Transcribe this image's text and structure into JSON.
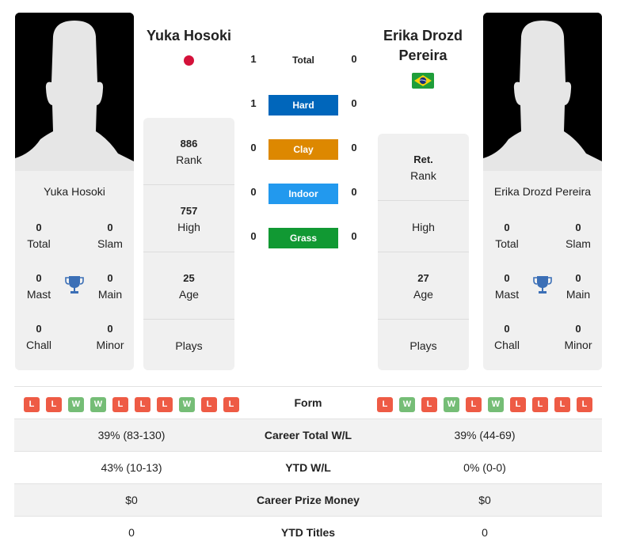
{
  "player1": {
    "name": "Yuka Hosoki",
    "flag": "japan-flag",
    "titles": {
      "total": {
        "value": "0",
        "label": "Total"
      },
      "slam": {
        "value": "0",
        "label": "Slam"
      },
      "mast": {
        "value": "0",
        "label": "Mast"
      },
      "main": {
        "value": "0",
        "label": "Main"
      },
      "chall": {
        "value": "0",
        "label": "Chall"
      },
      "minor": {
        "value": "0",
        "label": "Minor"
      }
    },
    "stats": {
      "rank": {
        "value": "886",
        "label": "Rank"
      },
      "high": {
        "value": "757",
        "label": "High"
      },
      "age": {
        "value": "25",
        "label": "Age"
      },
      "plays": {
        "value": "",
        "label": "Plays"
      }
    },
    "form": [
      "L",
      "L",
      "W",
      "W",
      "L",
      "L",
      "L",
      "W",
      "L",
      "L"
    ]
  },
  "player2": {
    "name_line1": "Erika Drozd",
    "name_line2": "Pereira",
    "name": "Erika Drozd Pereira",
    "flag": "brazil-flag",
    "titles": {
      "total": {
        "value": "0",
        "label": "Total"
      },
      "slam": {
        "value": "0",
        "label": "Slam"
      },
      "mast": {
        "value": "0",
        "label": "Mast"
      },
      "main": {
        "value": "0",
        "label": "Main"
      },
      "chall": {
        "value": "0",
        "label": "Chall"
      },
      "minor": {
        "value": "0",
        "label": "Minor"
      }
    },
    "stats": {
      "rank": {
        "value": "Ret.",
        "label": "Rank"
      },
      "high": {
        "value": "",
        "label": "High"
      },
      "age": {
        "value": "27",
        "label": "Age"
      },
      "plays": {
        "value": "",
        "label": "Plays"
      }
    },
    "form": [
      "L",
      "W",
      "L",
      "W",
      "L",
      "W",
      "L",
      "L",
      "L",
      "L"
    ]
  },
  "h2h": {
    "total": {
      "label": "Total",
      "p1": "1",
      "p2": "0"
    },
    "surfaces": [
      {
        "label": "Hard",
        "p1": "1",
        "p2": "0",
        "color": "#0066bb"
      },
      {
        "label": "Clay",
        "p1": "0",
        "p2": "0",
        "color": "#dd8800"
      },
      {
        "label": "Indoor",
        "p1": "0",
        "p2": "0",
        "color": "#2299ee"
      },
      {
        "label": "Grass",
        "p1": "0",
        "p2": "0",
        "color": "#119933"
      }
    ]
  },
  "comparison": {
    "form_label": "Form",
    "rows": [
      {
        "label": "Career Total W/L",
        "p1": "39% (83-130)",
        "p2": "39% (44-69)"
      },
      {
        "label": "YTD W/L",
        "p1": "43% (10-13)",
        "p2": "0% (0-0)"
      },
      {
        "label": "Career Prize Money",
        "p1": "$0",
        "p2": "$0"
      },
      {
        "label": "YTD Titles",
        "p1": "0",
        "p2": "0"
      }
    ]
  },
  "colors": {
    "win": "#75bd76",
    "loss": "#ee5b45",
    "trophy": "#3b6fb6"
  }
}
